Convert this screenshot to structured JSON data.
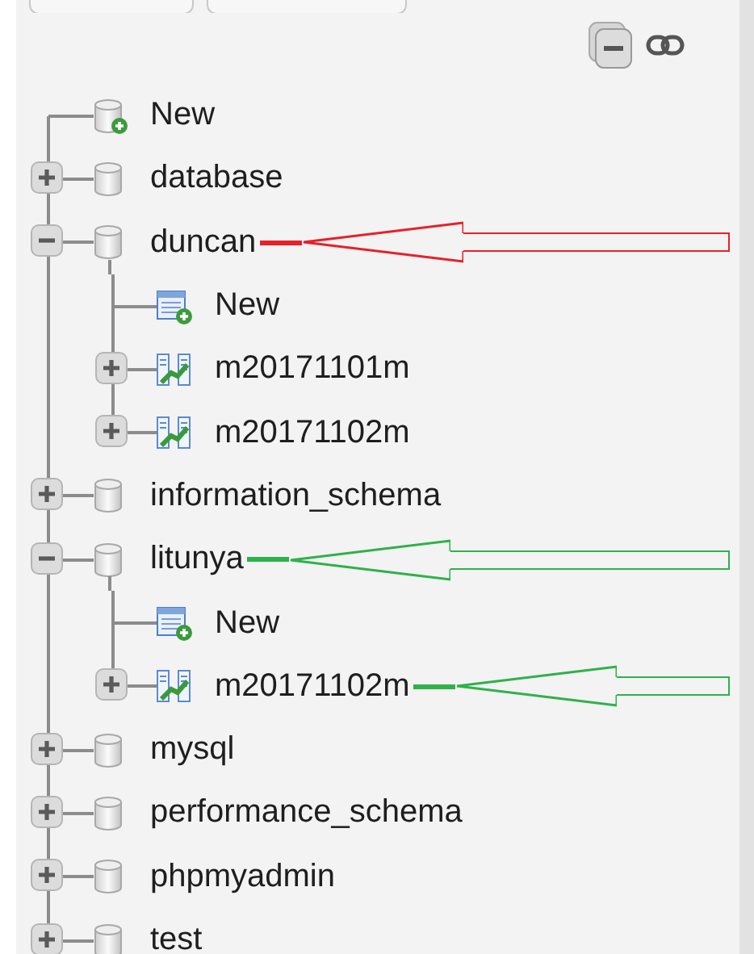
{
  "tree": [
    {
      "kind": "new-database",
      "label": "New"
    },
    {
      "kind": "database",
      "label": "database",
      "expanded": false
    },
    {
      "kind": "database",
      "label": "duncan",
      "expanded": true,
      "annotation": {
        "color": "#e8202a"
      },
      "children": [
        {
          "kind": "new-table",
          "label": "New"
        },
        {
          "kind": "table",
          "label": "m20171101m",
          "expanded": false
        },
        {
          "kind": "table",
          "label": "m20171102m",
          "expanded": false
        }
      ]
    },
    {
      "kind": "database",
      "label": "information_schema",
      "expanded": false
    },
    {
      "kind": "database",
      "label": "litunya",
      "expanded": true,
      "annotation": {
        "color": "#2db24a"
      },
      "children": [
        {
          "kind": "new-table",
          "label": "New"
        },
        {
          "kind": "table",
          "label": "m20171102m",
          "expanded": false,
          "annotation": {
            "color": "#2db24a"
          }
        }
      ]
    },
    {
      "kind": "database",
      "label": "mysql",
      "expanded": false
    },
    {
      "kind": "database",
      "label": "performance_schema",
      "expanded": false
    },
    {
      "kind": "database",
      "label": "phpmyadmin",
      "expanded": false
    },
    {
      "kind": "database",
      "label": "test",
      "expanded": false
    }
  ]
}
